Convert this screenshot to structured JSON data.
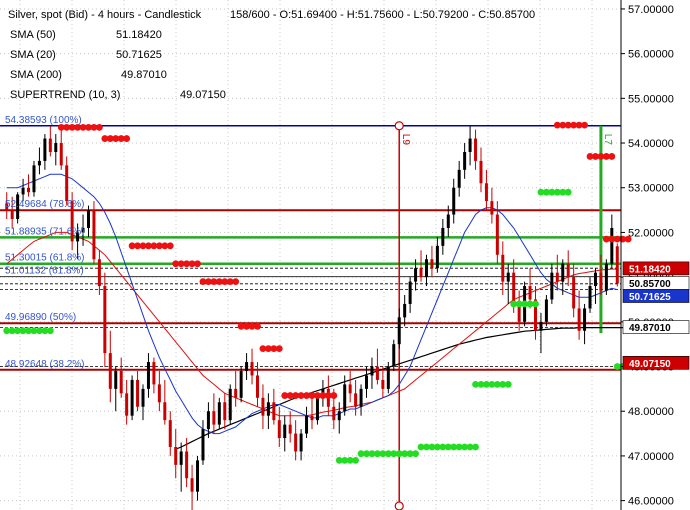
{
  "header": {
    "title": "Silver, spot (Bid) - 4 hours - Candlestick",
    "ohlc": "158/600 - O:51.69400 - H:51.75600 - L:50.79200 - C:50.85700",
    "indicators": [
      {
        "name": "SMA (50)",
        "value": "51.18420"
      },
      {
        "name": "SMA (20)",
        "value": "50.71625"
      },
      {
        "name": "SMA (200)",
        "value": "49.87010"
      },
      {
        "name": "SUPERTREND (10, 3)",
        "value": "49.07150"
      }
    ]
  },
  "colors": {
    "up": "#000000",
    "down": "#cc0000",
    "sma20": "#1a35cc",
    "sma50": "#e01010",
    "sma200": "#000000",
    "st_up": "#22dd22",
    "st_down": "#ee1111",
    "fib": "#0000aa",
    "level_red": "#aa0000",
    "level_green": "#22aa22",
    "vline": "#cc0000",
    "vline_green": "#22aa22"
  },
  "chart_data": {
    "type": "candlestick",
    "title": "Silver, spot (Bid) - 4 hours - Candlestick",
    "y_ticks": [
      "46.00000",
      "47.00000",
      "48.00000",
      "49.00000",
      "50.00000",
      "51.00000",
      "52.00000",
      "53.00000",
      "54.00000",
      "55.00000",
      "56.00000",
      "57.00000"
    ],
    "ylim": [
      45.79,
      57.2
    ],
    "grid": true,
    "fib_levels": [
      {
        "label": "54.38593 (100%)",
        "price": 54.38593
      },
      {
        "label": "52.49684 (78.6%)",
        "price": 52.49684
      },
      {
        "label": "51.88935 (71.6%)",
        "price": 51.88935
      },
      {
        "label": "51.30015 (61.8%)",
        "price": 51.30015
      },
      {
        "label": "51.01132 (61.8%)",
        "price": 51.01132
      },
      {
        "label": "49.96890 (50%)",
        "price": 49.9689
      },
      {
        "label": "48.92648 (38.2%)",
        "price": 48.92648
      }
    ],
    "vertical_markers": [
      {
        "label": "L9",
        "bar": 72
      },
      {
        "label": "L7",
        "bar": 109
      }
    ],
    "price_badges": [
      {
        "value": "51.18420",
        "bg": "#cc0000",
        "fg": "#ffffff"
      },
      {
        "value": "50.85700",
        "bg": "#ffffff",
        "fg": "#000000"
      },
      {
        "value": "50.71625",
        "bg": "#1a35cc",
        "fg": "#ffffff"
      },
      {
        "value": "49.87010",
        "bg": "#ffffff",
        "fg": "#000000"
      },
      {
        "value": "49.07150",
        "bg": "#cc0000",
        "fg": "#ffffff"
      }
    ],
    "candles": [
      [
        52.65,
        52.9,
        52.3,
        52.5
      ],
      [
        52.5,
        52.8,
        52.1,
        52.3
      ],
      [
        52.3,
        52.9,
        52.2,
        52.85
      ],
      [
        52.85,
        53.2,
        52.7,
        53.0
      ],
      [
        53.0,
        53.3,
        52.8,
        52.9
      ],
      [
        52.9,
        53.6,
        52.8,
        53.5
      ],
      [
        53.5,
        53.9,
        53.3,
        53.6
      ],
      [
        53.6,
        54.2,
        53.4,
        54.1
      ],
      [
        54.1,
        54.38,
        53.7,
        53.8
      ],
      [
        53.8,
        54.2,
        53.5,
        54.0
      ],
      [
        54.0,
        54.3,
        53.4,
        53.5
      ],
      [
        53.5,
        53.7,
        52.6,
        52.7
      ],
      [
        52.7,
        52.9,
        51.6,
        51.8
      ],
      [
        51.8,
        52.2,
        51.4,
        52.0
      ],
      [
        52.0,
        52.4,
        51.7,
        52.1
      ],
      [
        52.1,
        52.6,
        51.9,
        52.5
      ],
      [
        52.5,
        52.7,
        51.3,
        51.4
      ],
      [
        51.4,
        51.6,
        50.6,
        50.8
      ],
      [
        50.8,
        51.1,
        49.0,
        49.3
      ],
      [
        49.3,
        49.8,
        48.2,
        48.5
      ],
      [
        48.5,
        49.0,
        48.0,
        48.9
      ],
      [
        48.9,
        49.2,
        48.3,
        48.4
      ],
      [
        48.4,
        48.7,
        47.7,
        47.9
      ],
      [
        47.9,
        48.8,
        47.8,
        48.7
      ],
      [
        48.7,
        48.9,
        48.0,
        48.1
      ],
      [
        48.1,
        48.6,
        47.8,
        48.5
      ],
      [
        48.5,
        49.3,
        48.3,
        49.1
      ],
      [
        49.1,
        49.2,
        48.4,
        48.6
      ],
      [
        48.6,
        48.9,
        48.0,
        48.2
      ],
      [
        48.2,
        48.7,
        47.7,
        47.8
      ],
      [
        47.8,
        48.0,
        47.0,
        47.2
      ],
      [
        47.2,
        47.6,
        46.5,
        46.8
      ],
      [
        46.8,
        47.3,
        46.2,
        47.1
      ],
      [
        47.1,
        47.4,
        46.3,
        46.5
      ],
      [
        46.5,
        46.8,
        45.79,
        46.2
      ],
      [
        46.2,
        47.0,
        46.0,
        46.9
      ],
      [
        46.9,
        47.8,
        46.8,
        47.6
      ],
      [
        47.6,
        48.2,
        47.4,
        48.0
      ],
      [
        48.0,
        48.4,
        47.5,
        47.7
      ],
      [
        47.7,
        48.3,
        47.6,
        48.2
      ],
      [
        48.2,
        48.4,
        47.6,
        47.8
      ],
      [
        47.8,
        48.6,
        47.7,
        48.5
      ],
      [
        48.5,
        48.9,
        48.1,
        48.3
      ],
      [
        48.3,
        49.0,
        48.2,
        48.9
      ],
      [
        48.9,
        49.3,
        48.7,
        49.1
      ],
      [
        49.1,
        49.4,
        48.6,
        48.8
      ],
      [
        48.8,
        49.1,
        48.1,
        48.3
      ],
      [
        48.3,
        48.6,
        47.6,
        47.9
      ],
      [
        47.9,
        48.4,
        47.6,
        48.2
      ],
      [
        48.2,
        48.5,
        47.7,
        47.8
      ],
      [
        47.8,
        48.1,
        47.2,
        47.4
      ],
      [
        47.4,
        47.9,
        47.1,
        47.7
      ],
      [
        47.7,
        48.0,
        47.3,
        47.5
      ],
      [
        47.5,
        47.8,
        46.9,
        47.1
      ],
      [
        47.1,
        47.6,
        46.9,
        47.5
      ],
      [
        47.5,
        48.1,
        47.4,
        47.9
      ],
      [
        47.9,
        48.3,
        47.6,
        47.8
      ],
      [
        47.8,
        48.4,
        47.7,
        48.3
      ],
      [
        48.3,
        48.7,
        48.1,
        48.5
      ],
      [
        48.5,
        48.8,
        47.9,
        48.1
      ],
      [
        48.1,
        48.5,
        47.6,
        47.8
      ],
      [
        47.8,
        48.2,
        47.5,
        48.0
      ],
      [
        48.0,
        48.8,
        47.9,
        48.6
      ],
      [
        48.6,
        48.9,
        48.2,
        48.4
      ],
      [
        48.4,
        48.7,
        47.9,
        48.1
      ],
      [
        48.1,
        48.6,
        47.9,
        48.5
      ],
      [
        48.5,
        49.0,
        48.3,
        48.8
      ],
      [
        48.8,
        49.2,
        48.5,
        49.0
      ],
      [
        49.0,
        49.4,
        48.6,
        48.7
      ],
      [
        48.7,
        49.0,
        48.3,
        48.5
      ],
      [
        48.5,
        49.1,
        48.4,
        49.0
      ],
      [
        49.0,
        49.6,
        48.9,
        49.5
      ],
      [
        49.5,
        50.3,
        49.4,
        50.1
      ],
      [
        50.1,
        50.6,
        49.9,
        50.4
      ],
      [
        50.4,
        51.0,
        50.2,
        50.9
      ],
      [
        50.9,
        51.4,
        50.7,
        51.2
      ],
      [
        51.2,
        51.6,
        50.9,
        51.0
      ],
      [
        51.0,
        51.5,
        50.8,
        51.4
      ],
      [
        51.4,
        51.7,
        51.0,
        51.2
      ],
      [
        51.2,
        51.9,
        51.1,
        51.7
      ],
      [
        51.7,
        52.3,
        51.5,
        52.1
      ],
      [
        52.1,
        52.6,
        51.9,
        52.4
      ],
      [
        52.4,
        53.2,
        52.2,
        53.0
      ],
      [
        53.0,
        53.6,
        52.8,
        53.4
      ],
      [
        53.4,
        54.0,
        53.2,
        53.8
      ],
      [
        53.8,
        54.38,
        53.5,
        54.1
      ],
      [
        54.1,
        54.3,
        53.4,
        53.6
      ],
      [
        53.6,
        53.9,
        52.9,
        53.1
      ],
      [
        53.1,
        53.4,
        52.5,
        52.7
      ],
      [
        52.7,
        53.0,
        52.2,
        52.4
      ],
      [
        52.4,
        52.7,
        51.3,
        51.5
      ],
      [
        51.5,
        51.8,
        50.6,
        50.9
      ],
      [
        50.9,
        51.3,
        50.4,
        51.1
      ],
      [
        51.1,
        51.4,
        50.2,
        50.4
      ],
      [
        50.4,
        50.7,
        49.8,
        50.0
      ],
      [
        50.0,
        50.9,
        49.9,
        50.8
      ],
      [
        50.8,
        51.2,
        50.3,
        50.5
      ],
      [
        50.5,
        50.8,
        49.6,
        49.8
      ],
      [
        49.8,
        50.2,
        49.3,
        50.0
      ],
      [
        50.0,
        50.6,
        49.9,
        50.5
      ],
      [
        50.5,
        51.3,
        50.4,
        51.1
      ],
      [
        51.1,
        51.5,
        50.7,
        50.9
      ],
      [
        50.9,
        51.4,
        50.6,
        51.3
      ],
      [
        51.3,
        51.6,
        50.8,
        51.0
      ],
      [
        51.0,
        51.3,
        50.1,
        50.3
      ],
      [
        50.3,
        50.7,
        49.6,
        49.8
      ],
      [
        49.8,
        50.4,
        49.5,
        50.3
      ],
      [
        50.3,
        51.0,
        50.2,
        50.8
      ],
      [
        50.8,
        51.2,
        50.4,
        51.1
      ],
      [
        51.1,
        51.5,
        50.6,
        50.7
      ],
      [
        50.7,
        51.4,
        50.6,
        51.3
      ],
      [
        51.3,
        52.4,
        51.2,
        52.1
      ],
      [
        51.69,
        51.756,
        50.792,
        50.857
      ]
    ],
    "sma20": [
      53.0,
      53.0,
      53.0,
      53.05,
      53.1,
      53.15,
      53.2,
      53.25,
      53.3,
      53.3,
      53.3,
      53.25,
      53.2,
      53.1,
      53.0,
      52.9,
      52.8,
      52.65,
      52.45,
      52.2,
      51.9,
      51.55,
      51.2,
      50.85,
      50.5,
      50.15,
      49.8,
      49.5,
      49.2,
      48.95,
      48.7,
      48.45,
      48.25,
      48.05,
      47.85,
      47.7,
      47.6,
      47.55,
      47.5,
      47.5,
      47.55,
      47.6,
      47.65,
      47.75,
      47.85,
      47.95,
      48.0,
      48.05,
      48.1,
      48.15,
      48.15,
      48.1,
      48.05,
      48.0,
      47.95,
      47.9,
      47.85,
      47.85,
      47.9,
      47.9,
      47.9,
      47.95,
      48.0,
      48.05,
      48.05,
      48.1,
      48.15,
      48.2,
      48.25,
      48.3,
      48.35,
      48.45,
      48.6,
      48.8,
      49.0,
      49.3,
      49.6,
      49.9,
      50.2,
      50.5,
      50.8,
      51.1,
      51.4,
      51.7,
      52.0,
      52.2,
      52.4,
      52.5,
      52.55,
      52.55,
      52.5,
      52.4,
      52.25,
      52.1,
      51.9,
      51.7,
      51.5,
      51.3,
      51.1,
      50.95,
      50.85,
      50.75,
      50.7,
      50.65,
      50.6,
      50.55,
      50.55,
      50.55,
      50.6,
      50.65,
      50.7,
      50.75,
      50.72
    ],
    "sma50": [
      51.3,
      51.4,
      51.5,
      51.6,
      51.7,
      51.8,
      51.85,
      51.9,
      51.95,
      52.0,
      52.0,
      52.0,
      51.95,
      51.9,
      51.85,
      51.8,
      51.7,
      51.6,
      51.5,
      51.35,
      51.2,
      51.05,
      50.9,
      50.75,
      50.6,
      50.45,
      50.3,
      50.15,
      50.0,
      49.85,
      49.7,
      49.55,
      49.4,
      49.25,
      49.1,
      48.95,
      48.8,
      48.7,
      48.6,
      48.5,
      48.4,
      48.35,
      48.3,
      48.25,
      48.2,
      48.15,
      48.1,
      48.05,
      48.0,
      47.95,
      47.9,
      47.9,
      47.9,
      47.9,
      47.9,
      47.9,
      47.92,
      47.95,
      47.98,
      48.0,
      48.02,
      48.05,
      48.08,
      48.1,
      48.12,
      48.15,
      48.18,
      48.2,
      48.25,
      48.3,
      48.35,
      48.4,
      48.45,
      48.5,
      48.6,
      48.7,
      48.8,
      48.9,
      49.0,
      49.1,
      49.2,
      49.3,
      49.4,
      49.5,
      49.6,
      49.7,
      49.8,
      49.9,
      50.0,
      50.1,
      50.2,
      50.3,
      50.4,
      50.5,
      50.55,
      50.6,
      50.65,
      50.7,
      50.75,
      50.8,
      50.85,
      50.9,
      50.95,
      51.0,
      51.05,
      51.08,
      51.1,
      51.12,
      51.14,
      51.16,
      51.17,
      51.18,
      51.18
    ],
    "sma200": [
      null,
      null,
      null,
      null,
      null,
      null,
      null,
      null,
      null,
      null,
      null,
      null,
      null,
      null,
      null,
      null,
      null,
      null,
      null,
      null,
      null,
      null,
      null,
      null,
      null,
      null,
      null,
      null,
      null,
      null,
      null,
      47.15,
      47.2,
      47.26,
      47.32,
      47.38,
      47.44,
      47.5,
      47.55,
      47.6,
      47.65,
      47.7,
      47.75,
      47.8,
      47.85,
      47.9,
      47.95,
      48.0,
      48.05,
      48.1,
      48.15,
      48.2,
      48.25,
      48.3,
      48.34,
      48.38,
      48.42,
      48.46,
      48.5,
      48.54,
      48.58,
      48.62,
      48.66,
      48.7,
      48.74,
      48.78,
      48.82,
      48.86,
      48.9,
      48.94,
      48.98,
      49.02,
      49.06,
      49.1,
      49.14,
      49.18,
      49.22,
      49.26,
      49.3,
      49.34,
      49.38,
      49.42,
      49.46,
      49.5,
      49.53,
      49.56,
      49.59,
      49.62,
      49.65,
      49.67,
      49.69,
      49.71,
      49.73,
      49.75,
      49.77,
      49.79,
      49.8,
      49.81,
      49.82,
      49.83,
      49.84,
      49.85,
      49.86,
      49.86,
      49.86,
      49.87,
      49.87,
      49.87,
      49.87,
      49.87,
      49.87,
      49.87,
      49.87,
      49.87,
      49.87
    ],
    "supertrend": [
      {
        "from": 0,
        "to": 8,
        "price": 49.8,
        "dir": "up"
      },
      {
        "from": 10,
        "to": 17,
        "price": 54.35,
        "dir": "down"
      },
      {
        "from": 18,
        "to": 22,
        "price": 54.1,
        "dir": "down"
      },
      {
        "from": 23,
        "to": 30,
        "price": 51.7,
        "dir": "down"
      },
      {
        "from": 31,
        "to": 35,
        "price": 51.3,
        "dir": "down"
      },
      {
        "from": 36,
        "to": 42,
        "price": 50.9,
        "dir": "down"
      },
      {
        "from": 43,
        "to": 46,
        "price": 49.9,
        "dir": "down"
      },
      {
        "from": 47,
        "to": 50,
        "price": 49.4,
        "dir": "down"
      },
      {
        "from": 51,
        "to": 60,
        "price": 48.35,
        "dir": "down"
      },
      {
        "from": 61,
        "to": 64,
        "price": 46.9,
        "dir": "up"
      },
      {
        "from": 65,
        "to": 75,
        "price": 47.05,
        "dir": "up"
      },
      {
        "from": 76,
        "to": 86,
        "price": 47.2,
        "dir": "up"
      },
      {
        "from": 86,
        "to": 92,
        "price": 48.6,
        "dir": "up"
      },
      {
        "from": 93,
        "to": 97,
        "price": 50.4,
        "dir": "up"
      },
      {
        "from": 98,
        "to": 103,
        "price": 52.9,
        "dir": "up"
      },
      {
        "from": 101,
        "to": 106,
        "price": 54.4,
        "dir": "down"
      },
      {
        "from": 107,
        "to": 111,
        "price": 53.7,
        "dir": "down"
      },
      {
        "from": 110,
        "to": 114,
        "price": 51.85,
        "dir": "down"
      },
      {
        "from": 112,
        "to": 117,
        "price": 49.0,
        "dir": "up"
      }
    ]
  }
}
